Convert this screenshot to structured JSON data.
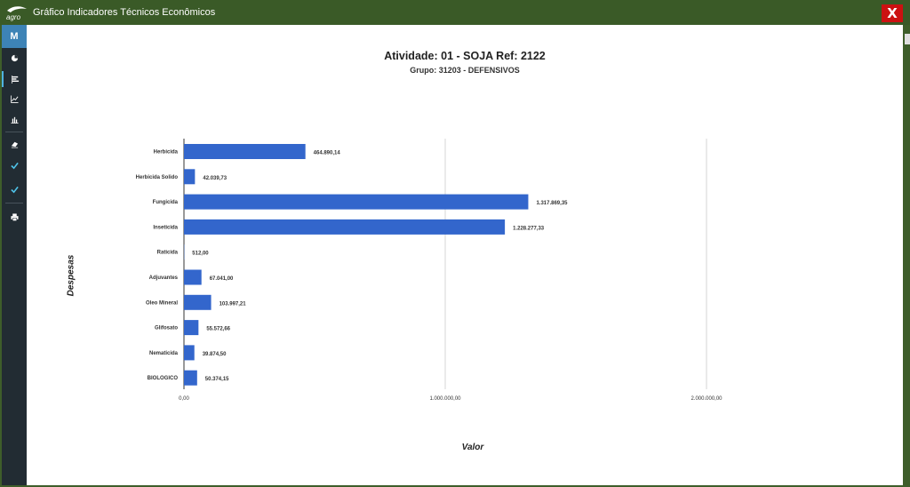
{
  "window": {
    "title": "Gráfico Indicadores Técnicos Econômicos",
    "logo_text": "agro",
    "close_label": "X"
  },
  "sidebar": {
    "menu_label": "M",
    "items": [
      {
        "icon": "pie-chart-icon"
      },
      {
        "icon": "bar-chart-icon"
      },
      {
        "icon": "line-chart-icon"
      },
      {
        "icon": "column-chart-icon"
      },
      {
        "icon": "eraser-icon"
      },
      {
        "icon": "check-icon"
      },
      {
        "icon": "check-icon"
      },
      {
        "icon": "print-icon"
      }
    ]
  },
  "chart_data": {
    "type": "bar",
    "orientation": "horizontal",
    "title": "Atividade: 01 - SOJA Ref: 2122",
    "subtitle": "Grupo: 31203 - DEFENSIVOS",
    "ylabel": "Despesas",
    "xlabel": "Valor",
    "categories": [
      "Herbicida",
      "Herbicida Solido",
      "Fungicida",
      "Inseticida",
      "Raticida",
      "Adjuvantes",
      "Oleo Mineral",
      "Glifosato",
      "Nematicida",
      "BIOLOGICO"
    ],
    "values": [
      464890.14,
      42039.73,
      1317869.35,
      1228277.33,
      512.0,
      67041.0,
      103997.21,
      55572.66,
      39874.5,
      50374.15
    ],
    "value_labels": [
      "464.890,14",
      "42.039,73",
      "1.317.869,35",
      "1.228.277,33",
      "512,00",
      "67.041,00",
      "103.997,21",
      "55.572,66",
      "39.874,50",
      "50.374,15"
    ],
    "xticks": [
      0,
      1000000,
      2000000
    ],
    "xtick_labels": [
      "0,00",
      "1.000.000,00",
      "2.000.000,00"
    ],
    "xlim": [
      0,
      2500000
    ],
    "grid": true,
    "bar_color": "#3366cc"
  }
}
